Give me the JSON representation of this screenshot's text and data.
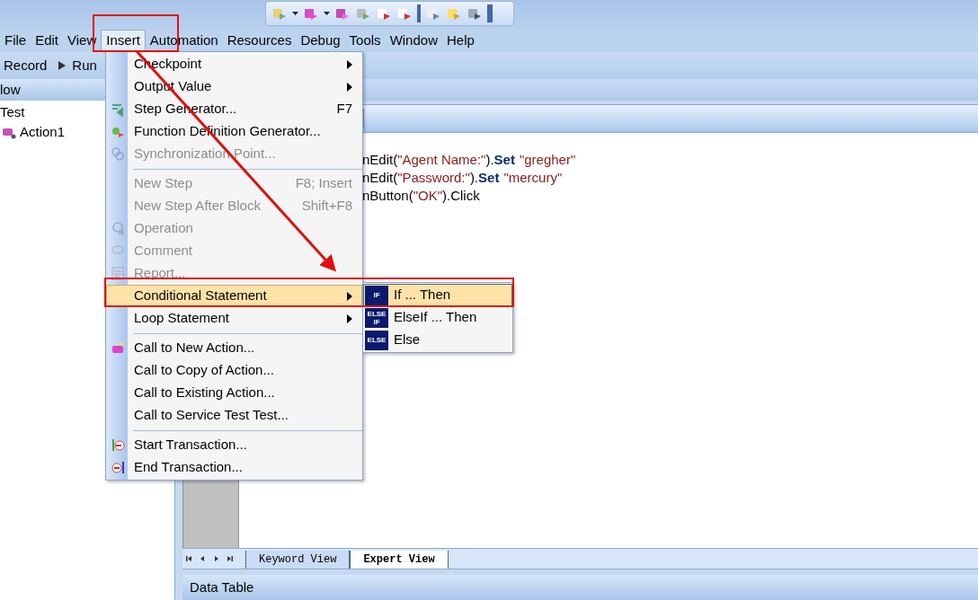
{
  "menubar": [
    {
      "label": "File",
      "selected": false
    },
    {
      "label": "Edit",
      "selected": false
    },
    {
      "label": "View",
      "selected": false
    },
    {
      "label": "Insert",
      "selected": true
    },
    {
      "label": "Automation",
      "selected": false
    },
    {
      "label": "Resources",
      "selected": false
    },
    {
      "label": "Debug",
      "selected": false
    },
    {
      "label": "Tools",
      "selected": false
    },
    {
      "label": "Window",
      "selected": false
    },
    {
      "label": "Help",
      "selected": false
    }
  ],
  "toolbar": [
    {
      "label": "Record"
    },
    {
      "label": "Run"
    }
  ],
  "left_pane": {
    "title": "low",
    "tree": [
      {
        "label": "Test",
        "children": [
          {
            "label": "Action1"
          }
        ]
      }
    ]
  },
  "code_lines": [
    [
      {
        "kind": "plain",
        "text": "nEdit("
      },
      {
        "kind": "string",
        "text": "\"Agent Name:\""
      },
      {
        "kind": "plain",
        "text": ")."
      },
      {
        "kind": "keyword",
        "text": "Set"
      },
      {
        "kind": "string",
        "text": "\"gregher\""
      }
    ],
    [
      {
        "kind": "plain",
        "text": "nEdit("
      },
      {
        "kind": "string",
        "text": "\"Password:\""
      },
      {
        "kind": "plain",
        "text": ")."
      },
      {
        "kind": "keyword",
        "text": "Set"
      },
      {
        "kind": "string",
        "text": "\"mercury\""
      }
    ],
    [
      {
        "kind": "plain",
        "text": "nButton("
      },
      {
        "kind": "string",
        "text": "\"OK\""
      },
      {
        "kind": "plain",
        "text": ").Click"
      }
    ]
  ],
  "view_tabs": [
    {
      "label": "Keyword View",
      "selected": false
    },
    {
      "label": "Expert View",
      "selected": true
    }
  ],
  "bottom_panel": {
    "title": "Data Table"
  },
  "insert_menu": [
    {
      "kind": "item",
      "label": "Checkpoint",
      "submenu": true,
      "disabled": false,
      "selected": false
    },
    {
      "kind": "item",
      "label": "Output Value",
      "submenu": true,
      "disabled": false,
      "selected": false
    },
    {
      "kind": "item",
      "label": "Step Generator...",
      "shortcut": "F7",
      "submenu": false,
      "disabled": false,
      "selected": false
    },
    {
      "kind": "item",
      "label": "Function Definition Generator...",
      "submenu": false,
      "disabled": false,
      "selected": false
    },
    {
      "kind": "item",
      "label": "Synchronization Point...",
      "submenu": false,
      "disabled": true,
      "selected": false
    },
    {
      "kind": "separator"
    },
    {
      "kind": "item",
      "label": "New Step",
      "shortcut": "F8; Insert",
      "submenu": false,
      "disabled": true,
      "selected": false
    },
    {
      "kind": "item",
      "label": "New Step After Block",
      "shortcut": "Shift+F8",
      "submenu": false,
      "disabled": true,
      "selected": false
    },
    {
      "kind": "item",
      "label": "Operation",
      "submenu": false,
      "disabled": true,
      "selected": false
    },
    {
      "kind": "item",
      "label": "Comment",
      "submenu": false,
      "disabled": true,
      "selected": false
    },
    {
      "kind": "item",
      "label": "Report...",
      "submenu": false,
      "disabled": true,
      "selected": false
    },
    {
      "kind": "item",
      "label": "Conditional Statement",
      "submenu": true,
      "disabled": false,
      "selected": true
    },
    {
      "kind": "item",
      "label": "Loop Statement",
      "submenu": true,
      "disabled": false,
      "selected": false
    },
    {
      "kind": "separator"
    },
    {
      "kind": "item",
      "label": "Call to New Action...",
      "submenu": false,
      "disabled": false,
      "selected": false
    },
    {
      "kind": "item",
      "label": "Call to Copy of Action...",
      "submenu": false,
      "disabled": false,
      "selected": false
    },
    {
      "kind": "item",
      "label": "Call to Existing Action...",
      "submenu": false,
      "disabled": false,
      "selected": false
    },
    {
      "kind": "item",
      "label": "Call to Service Test Test...",
      "submenu": false,
      "disabled": false,
      "selected": false
    },
    {
      "kind": "separator"
    },
    {
      "kind": "item",
      "label": "Start Transaction...",
      "submenu": false,
      "disabled": false,
      "selected": false
    },
    {
      "kind": "item",
      "label": "End Transaction...",
      "submenu": false,
      "disabled": false,
      "selected": false
    }
  ],
  "conditional_submenu": [
    {
      "badge": "IF",
      "label": "If ... Then",
      "selected": true
    },
    {
      "badge": "ELSE IF",
      "label": "ElseIf ... Then",
      "selected": false
    },
    {
      "badge": "ELSE",
      "label": "Else",
      "selected": false
    }
  ]
}
